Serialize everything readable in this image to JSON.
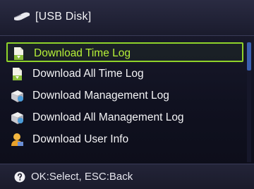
{
  "header": {
    "title": "[USB Disk]",
    "icon": "usb-disk-icon"
  },
  "menu": {
    "selected_index": 0,
    "items": [
      {
        "label": "Download Time Log",
        "icon": "document-download-icon"
      },
      {
        "label": "Download All Time Log",
        "icon": "document-download-icon"
      },
      {
        "label": "Download Management Log",
        "icon": "management-log-icon"
      },
      {
        "label": "Download All Management Log",
        "icon": "management-log-icon"
      },
      {
        "label": "Download User Info",
        "icon": "user-icon"
      }
    ]
  },
  "footer": {
    "hint": "OK:Select, ESC:Back",
    "icon": "help-icon"
  },
  "colors": {
    "selection_border": "#8fd32a",
    "selected_text": "#b7f238",
    "background": "#101120",
    "scroll_thumb": "#3b5fb0"
  }
}
